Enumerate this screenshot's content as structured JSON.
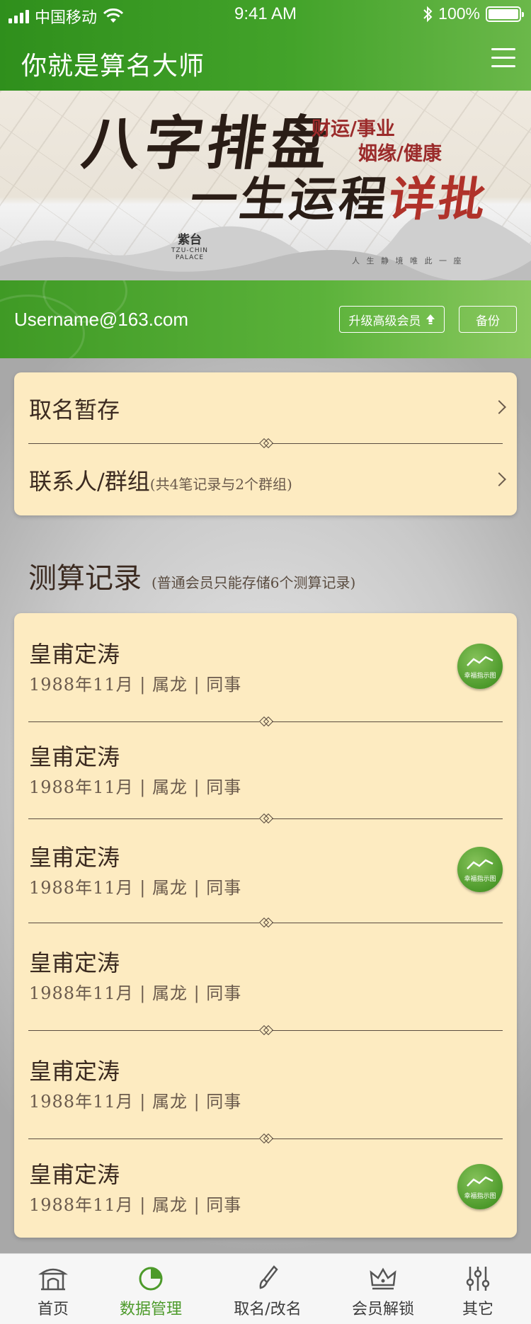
{
  "status_bar": {
    "carrier": "中国移动",
    "time": "9:41 AM",
    "battery": "100%",
    "icons": [
      "signal-icon",
      "wifi-icon",
      "bluetooth-icon",
      "battery-icon"
    ]
  },
  "header": {
    "title": "你就是算名大师",
    "menu_icon": "hamburger-menu-icon"
  },
  "banner": {
    "headline": "八字排盘",
    "subline_dark": "一生运程",
    "subline_red": "详批",
    "tag_1": "财运/事业",
    "tag_2": "姻缘/健康",
    "logo_cn": "紫台",
    "logo_en": "TZU-CHIN",
    "logo_en2": "PALACE",
    "slogan": "人 生 静 境 唯 此 一 座"
  },
  "user": {
    "username": "Username@163.com",
    "upgrade_label": "升级高级会员",
    "backup_label": "备份"
  },
  "storage_card": {
    "item_1": "取名暂存",
    "item_2": "联系人/群组",
    "item_2_note": "(共4笔记录与2个群组)"
  },
  "records_section": {
    "title": "测算记录",
    "note": "(普通会员只能存储6个测算记录)"
  },
  "records": [
    {
      "name": "皇甫定涛",
      "meta": "1988年11月 | 属龙 | 同事",
      "badge": "幸福指示图"
    },
    {
      "name": "皇甫定涛",
      "meta": "1988年11月 | 属龙 | 同事",
      "badge": ""
    },
    {
      "name": "皇甫定涛",
      "meta": "1988年11月 | 属龙 | 同事",
      "badge": "幸福指示图"
    },
    {
      "name": "皇甫定涛",
      "meta": "1988年11月 | 属龙 | 同事",
      "badge": ""
    },
    {
      "name": "皇甫定涛",
      "meta": "1988年11月 | 属龙 | 同事",
      "badge": ""
    },
    {
      "name": "皇甫定涛",
      "meta": "1988年11月 | 属龙 | 同事",
      "badge": "幸福指示图"
    }
  ],
  "tabbar": {
    "tabs": [
      {
        "label": "首页",
        "icon": "home-temple-icon"
      },
      {
        "label": "数据管理",
        "icon": "pie-chart-icon"
      },
      {
        "label": "取名/改名",
        "icon": "brush-icon"
      },
      {
        "label": "会员解锁",
        "icon": "crown-icon"
      },
      {
        "label": "其它",
        "icon": "sliders-icon"
      }
    ],
    "active_index": 1,
    "active_color": "#4c9a2a"
  },
  "colors": {
    "header_green": "#43a32a",
    "card_bg": "#fdebc1",
    "text_brown": "#3b2a20"
  }
}
